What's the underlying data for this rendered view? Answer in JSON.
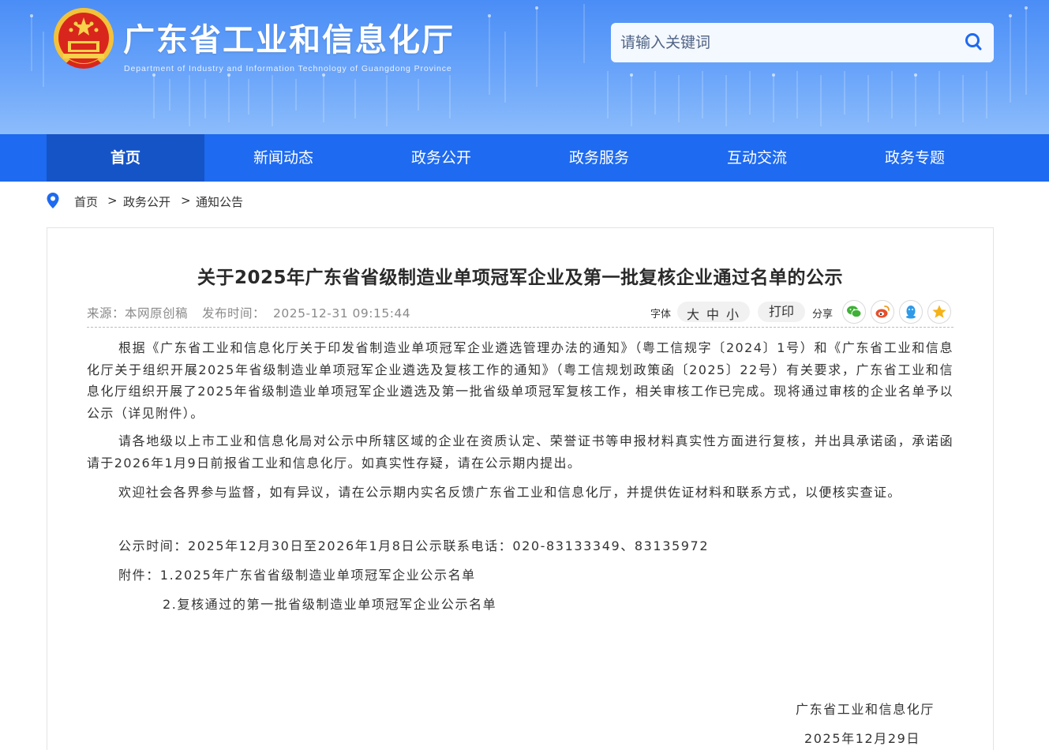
{
  "header": {
    "title": "广东省工业和信息化厅",
    "subtitle": "Department of Industry and Information Technology of Guangdong Province",
    "emblem": "national-emblem"
  },
  "search": {
    "placeholder": "请输入关键词",
    "icon": "search-icon"
  },
  "nav": {
    "items": [
      {
        "label": "首页",
        "active": true
      },
      {
        "label": "新闻动态",
        "active": false
      },
      {
        "label": "政务公开",
        "active": false
      },
      {
        "label": "政务服务",
        "active": false
      },
      {
        "label": "互动交流",
        "active": false
      },
      {
        "label": "政务专题",
        "active": false
      }
    ]
  },
  "breadcrumb": {
    "icon": "location-pin-icon",
    "items": [
      "首页",
      "政务公开",
      "通知公告"
    ],
    "separator": ">"
  },
  "article": {
    "title": "关于2025年广东省省级制造业单项冠军企业及第一批复核企业通过名单的公示",
    "source": "来源：本网原创稿",
    "publish_label": "发布时间：",
    "publish_time": "2025-12-31 09:15:44",
    "paragraphs": [
      "根据《广东省工业和信息化厅关于印发省制造业单项冠军企业遴选管理办法的通知》（粤工信规字〔2024〕1号）和《广东省工业和信息化厅关于组织开展2025年省级制造业单项冠军企业遴选及复核工作的通知》（粤工信规划政策函〔2025〕22号）有关要求，广东省工业和信息化厅组织开展了2025年省级制造业单项冠军企业遴选及第一批省级单项冠军复核工作，相关审核工作已完成。现将通过审核的企业名单予以公示（详见附件）。",
      "请各地级以上市工业和信息化局对公示中所辖区域的企业在资质认定、荣誉证书等申报材料真实性方面进行复核，并出具承诺函，承诺函请于2026年1月9日前报省工业和信息化厅。如真实性存疑，请在公示期内提出。",
      "欢迎社会各界参与监督，如有异议，请在公示期内实名反馈广东省工业和信息化厅，并提供佐证材料和联系方式，以便核实查证。"
    ],
    "notice_period": "公示时间：2025年12月30日至2026年1月8日公示联系电话：020-83133349、83135972",
    "attachment_1": "附件：1.2025年广东省省级制造业单项冠军企业公示名单",
    "attachment_2": "2.复核通过的第一批省级制造业单项冠军企业公示名单",
    "signature": "广东省工业和信息化厅",
    "date": "2025年12月29日"
  },
  "tools": {
    "font_label": "字体",
    "font_sizes": [
      "大",
      "中",
      "小"
    ],
    "print_label": "打印",
    "share_label": "分享",
    "share_icons": [
      "wechat-icon",
      "weibo-icon",
      "qq-icon",
      "qzone-icon"
    ],
    "colors": {
      "wechat": "#3fb036",
      "weibo": "#e6502c",
      "qq": "#2f9ae8",
      "qzone": "#f5b31a"
    }
  },
  "theme": {
    "nav_bg": "#1e6af0",
    "nav_active_bg": "#1554c6",
    "banner": "#4a8df6"
  }
}
